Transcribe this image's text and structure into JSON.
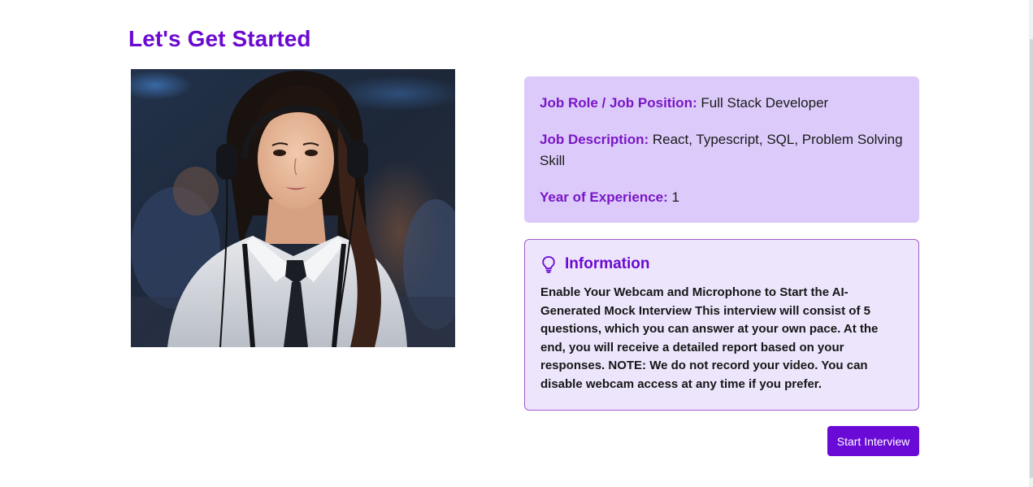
{
  "page": {
    "title": "Let's Get Started"
  },
  "job_details": {
    "role_label": "Job Role / Job Position:",
    "role_value": "Full Stack Developer",
    "description_label": "Job Description:",
    "description_value": "React, Typescript, SQL, Problem Solving Skill",
    "experience_label": "Year of Experience:",
    "experience_value": "1"
  },
  "information": {
    "icon": "lightbulb-icon",
    "heading": "Information",
    "text": "Enable Your Webcam and Microphone to Start the AI-Generated Mock Interview This interview will consist of 5 questions, which you can answer at your own pace. At the end, you will receive a detailed report based on your responses. NOTE: We do not record your video. You can disable webcam access at any time if you prefer."
  },
  "actions": {
    "start_label": "Start Interview"
  },
  "colors": {
    "accent": "#6b0ad0",
    "job_card_bg": "#dccbfa",
    "info_card_bg": "#ede5fc",
    "info_border": "#a25ac9",
    "button_bg": "#6a0ad6"
  }
}
